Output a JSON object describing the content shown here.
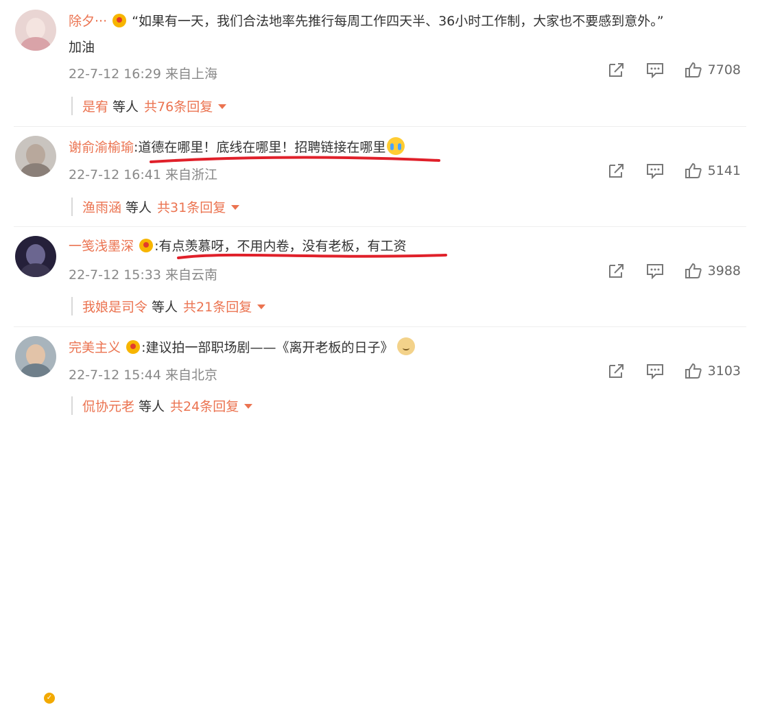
{
  "comments": [
    {
      "username": "除夕···",
      "text": "“如果有一天，我们合法地率先推行每周工作四天半、36小时工作制，大家也不要感到意外。”",
      "text2": "加油",
      "time": "22-7-12 16:29",
      "location": "来自上海",
      "likes": "7708",
      "reply_user": "是宥",
      "reply_etc": "等人",
      "reply_count": "共76条回复",
      "avatar_color": "#d9a3a8"
    },
    {
      "username": "谢俞渝榆瑜",
      "text": ":道德在哪里！底线在哪里！招聘链接在哪里",
      "time": "22-7-12 16:41",
      "location": "来自浙江",
      "likes": "5141",
      "reply_user": "渔雨涵",
      "reply_etc": "等人",
      "reply_count": "共31条回复",
      "avatar_color": "#8a7f78"
    },
    {
      "username": "一笺浅墨深",
      "text": ":有点羡慕呀，不用内卷，没有老板，有工资",
      "time": "22-7-12 15:33",
      "location": "来自云南",
      "likes": "3988",
      "reply_user": "我娘是司令",
      "reply_etc": "等人",
      "reply_count": "共21条回复",
      "avatar_color": "#3a3550"
    },
    {
      "username": "完美主义",
      "text": ":建议拍一部职场剧——《离开老板的日子》",
      "time": "22-7-12 15:44",
      "location": "来自北京",
      "likes": "3103",
      "reply_user": "侃协元老",
      "reply_etc": "等人",
      "reply_count": "共24条回复",
      "avatar_color": "#6f7f8a"
    }
  ],
  "colors": {
    "accent": "#eb7350",
    "underline": "#e0202a",
    "meta": "#888888"
  },
  "icons": [
    "share-icon",
    "comment-icon",
    "like-icon",
    "expand-caret-icon"
  ]
}
